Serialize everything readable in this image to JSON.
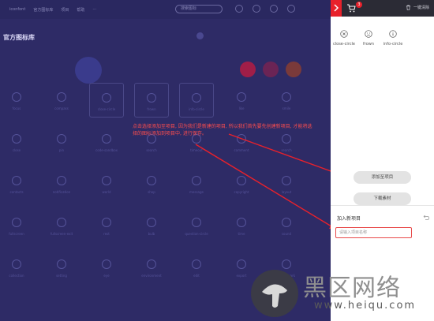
{
  "nav": {
    "items": [
      "iconfont",
      "官方图标库",
      "项目",
      "帮助",
      "···"
    ],
    "search_placeholder": "搜索图标"
  },
  "page": {
    "title": "官方图标库"
  },
  "grid": {
    "labels": [
      "focus",
      "compass",
      "close-circle",
      "frown",
      "info-circle",
      "like",
      "smile",
      "close",
      "pin",
      "code-sandbox",
      "search",
      "timeout",
      "comment",
      "search",
      "contacts",
      "notification",
      "world",
      "shop",
      "message",
      "copyright",
      "layout",
      "fullscreen",
      "fullscreen-exit",
      "rest",
      "bulb",
      "question-circle",
      "time",
      "sound",
      "collection",
      "setting",
      "eye",
      "environment",
      "edit",
      "export",
      "checkmark"
    ]
  },
  "annotation": {
    "text": "点击选择添加至项目, 因为我们是新建的项目, 所以我们首先要先创建新项目, 才能将选择的图标添加到项目中, 进行保存。"
  },
  "panel": {
    "close_icon": "chevron-right",
    "cart_count": "3",
    "clear_label": "一键清除",
    "selected_icons": [
      {
        "label": "close-circle",
        "icon": "close-circle"
      },
      {
        "label": "frown",
        "icon": "frown"
      },
      {
        "label": "info-circle",
        "icon": "info-circle"
      }
    ],
    "add_to_project_label": "添加至项目",
    "download_label": "下载素材",
    "new_project_label": "加入新项目",
    "new_project_placeholder": "请输入项目名称"
  },
  "watermark": {
    "text": "黑区网络",
    "url": "www.heiqu.com"
  },
  "colors": {
    "accent": "#e8212b",
    "bg": "#2e2b66",
    "annotation": "#ff4d4d"
  }
}
